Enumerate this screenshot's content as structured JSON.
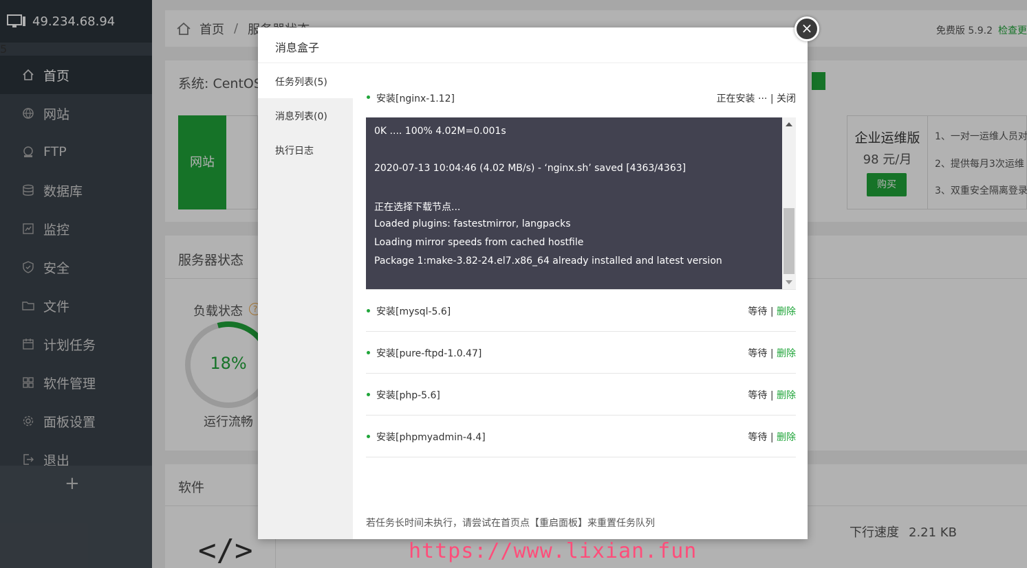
{
  "sidebar": {
    "ip": "49.234.68.94",
    "badge": "5",
    "items": [
      {
        "label": "首页",
        "icon": "home-icon"
      },
      {
        "label": "网站",
        "icon": "globe-icon"
      },
      {
        "label": "FTP",
        "icon": "ftp-icon"
      },
      {
        "label": "数据库",
        "icon": "database-icon"
      },
      {
        "label": "监控",
        "icon": "monitor-icon"
      },
      {
        "label": "安全",
        "icon": "shield-icon"
      },
      {
        "label": "文件",
        "icon": "folder-icon"
      },
      {
        "label": "计划任务",
        "icon": "calendar-icon"
      },
      {
        "label": "软件管理",
        "icon": "grid-icon"
      },
      {
        "label": "面板设置",
        "icon": "gear-icon"
      },
      {
        "label": "退出",
        "icon": "logout-icon"
      }
    ],
    "add": "+"
  },
  "breadcrumb": {
    "home": "首页",
    "sep": "/",
    "current": "服务器状态"
  },
  "version": {
    "label": "免费版 5.9.2",
    "check": "检查更"
  },
  "system": {
    "label": "系统: CentOS"
  },
  "stats": {
    "website": "网站"
  },
  "vip": {
    "title": "企业运维版",
    "price": "98 元/月",
    "buy": "购买",
    "lines": [
      "1、一对一运维人员对",
      "2、提供每月3次运维",
      "3、双重安全隔离登录"
    ]
  },
  "server": {
    "title": "服务器状态",
    "load_label": "负载状态",
    "load_value": "18%",
    "load_percent": 18,
    "load_status": "运行流畅"
  },
  "software": {
    "title": "软件",
    "speed_label": "下行速度",
    "speed_value": "2.21 KB"
  },
  "modal": {
    "title": "消息盒子",
    "close": "×",
    "nav": [
      "任务列表(5)",
      "消息列表(0)",
      "执行日志"
    ],
    "active_task": {
      "name": "安装[nginx-1.12]",
      "status": "正在安装 ···",
      "sep": " | ",
      "close": "关闭"
    },
    "log_lines": [
      "0K .... 100% 4.02M=0.001s",
      "2020-07-13 10:04:46 (4.02 MB/s) - ‘nginx.sh’ saved [4363/4363]",
      "正在选择下载节点...",
      "Loaded plugins: fastestmirror, langpacks",
      "Loading mirror speeds from cached hostfile",
      "Package 1:make-3.82-24.el7.x86_64 already installed and latest version"
    ],
    "tasks": [
      {
        "name": "安装[mysql-5.6]",
        "status": "等待",
        "sep": " | ",
        "del": "删除"
      },
      {
        "name": "安装[pure-ftpd-1.0.47]",
        "status": "等待",
        "sep": " | ",
        "del": "删除"
      },
      {
        "name": "安装[php-5.6]",
        "status": "等待",
        "sep": " | ",
        "del": "删除"
      },
      {
        "name": "安装[phpmyadmin-4.4]",
        "status": "等待",
        "sep": " | ",
        "del": "删除"
      }
    ],
    "tip": "若任务长时间未执行，请尝试在首页点【重启面板】来重置任务队列"
  },
  "watermark": "https://www.lixian.fun"
}
